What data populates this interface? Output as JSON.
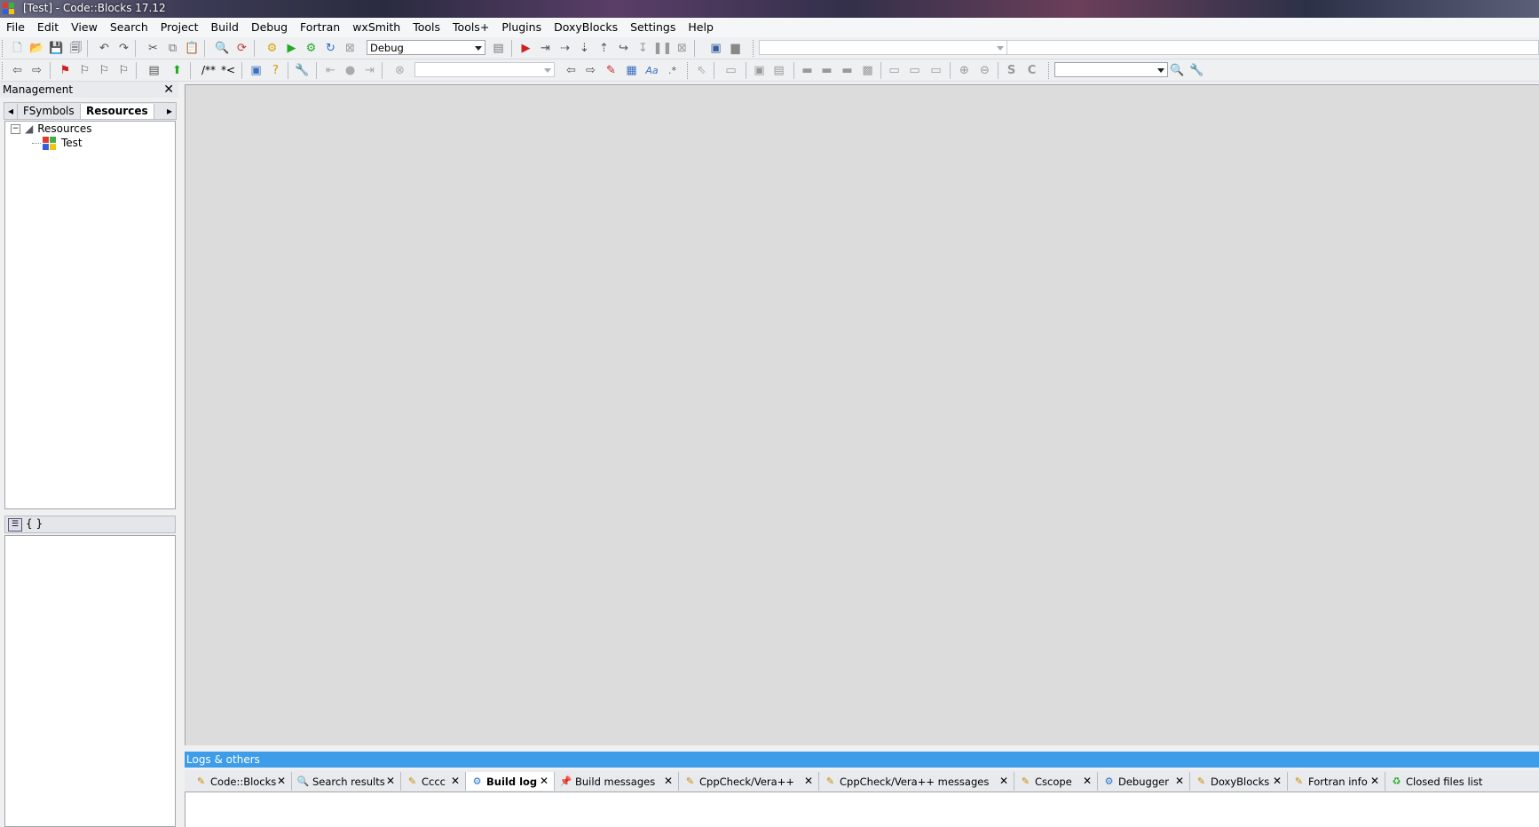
{
  "window": {
    "title": "[Test] - Code::Blocks 17.12"
  },
  "menu": [
    "File",
    "Edit",
    "View",
    "Search",
    "Project",
    "Build",
    "Debug",
    "Fortran",
    "wxSmith",
    "Tools",
    "Tools+",
    "Plugins",
    "DoxyBlocks",
    "Settings",
    "Help"
  ],
  "toolbar": {
    "build_target": "Debug",
    "scope_combo": "",
    "function_combo": "",
    "search_combo": "",
    "comment_block": "/**",
    "comment_line": "*<"
  },
  "management": {
    "title": "Management",
    "close": "✕",
    "tabs": [
      "FSymbols",
      "Resources"
    ],
    "active_tab": "Resources",
    "tree": {
      "root": "Resources",
      "child": "Test"
    },
    "symbols_label": "{ }"
  },
  "logs": {
    "title": "Logs & others",
    "tabs": [
      "Code::Blocks",
      "Search results",
      "Cccc",
      "Build log",
      "Build messages",
      "CppCheck/Vera++",
      "CppCheck/Vera++ messages",
      "Cscope",
      "Debugger",
      "DoxyBlocks",
      "Fortran info",
      "Closed files list"
    ],
    "active_tab": "Build log"
  },
  "colors": {
    "logs_header": "#3d9de8",
    "editor_bg": "#dcdcdc"
  }
}
